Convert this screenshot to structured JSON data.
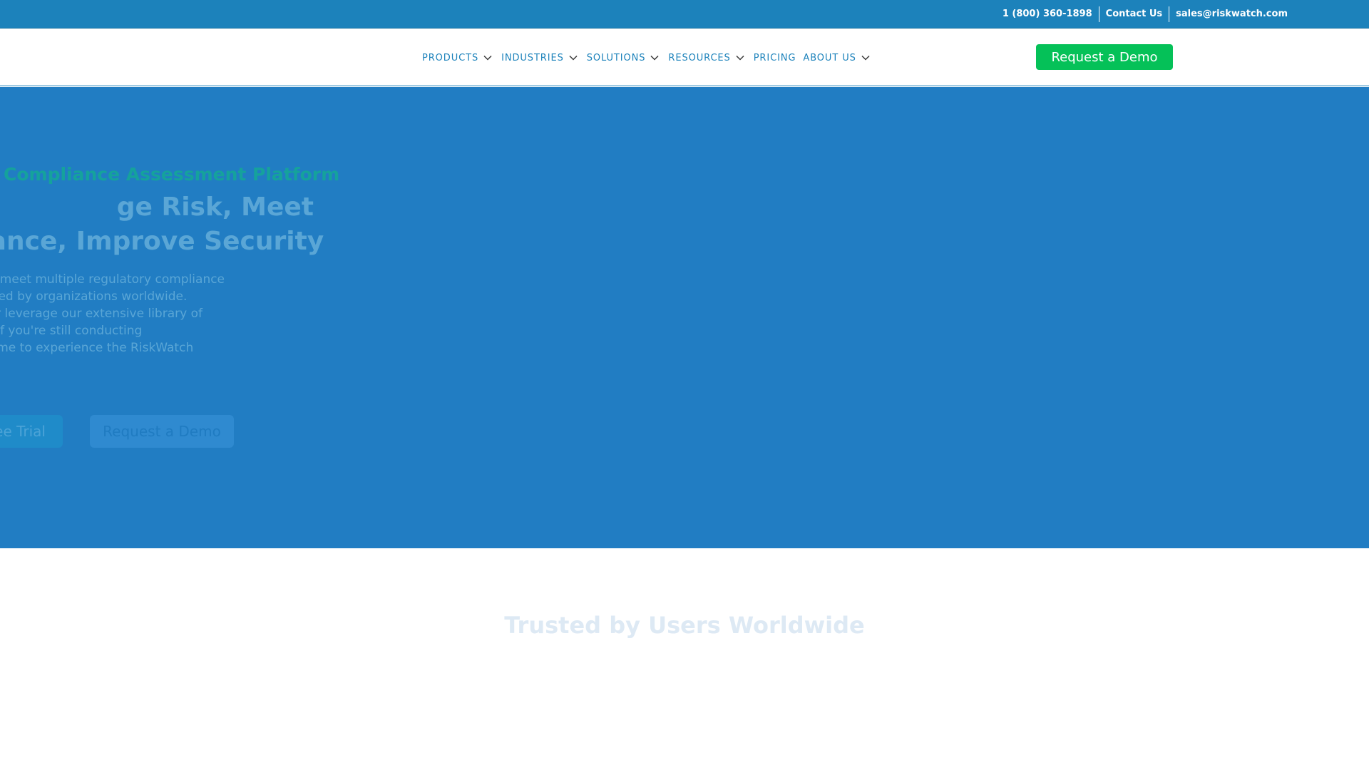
{
  "topbar": {
    "phone": "1 (800) 360-1898",
    "contact": "Contact Us",
    "email": "sales@riskwatch.com"
  },
  "nav": {
    "items": [
      {
        "label": "PRODUCTS",
        "has_dropdown": true
      },
      {
        "label": "INDUSTRIES",
        "has_dropdown": true
      },
      {
        "label": "SOLUTIONS",
        "has_dropdown": true
      },
      {
        "label": "RESOURCES",
        "has_dropdown": true
      },
      {
        "label": "PRICING",
        "has_dropdown": false
      },
      {
        "label": "ABOUT US",
        "has_dropdown": true
      }
    ],
    "cta_label": "Request a Demo"
  },
  "hero": {
    "eyebrow": "Compliance Assessment Platform",
    "heading_lines": [
      "ge Risk, Meet",
      "liance, Improve Security"
    ],
    "body_lines": [
      "tch, manage and meet multiple regulatory compliance",
      "quirements, trusted by organizations worldwide.",
      "custom criteria or leverage our extensive library of",
      "atory standards. If you're still conducting",
      "s manually, it's time to experience the RiskWatch"
    ],
    "trial_label": "ee Trial",
    "demo_label": "Request a Demo"
  },
  "trusted": {
    "title": "Trusted by Users Worldwide"
  },
  "colors": {
    "topbar": "#1c82bb",
    "hero": "#217dc3",
    "cta_green": "#05c158",
    "nav_text": "#1c82bb"
  }
}
